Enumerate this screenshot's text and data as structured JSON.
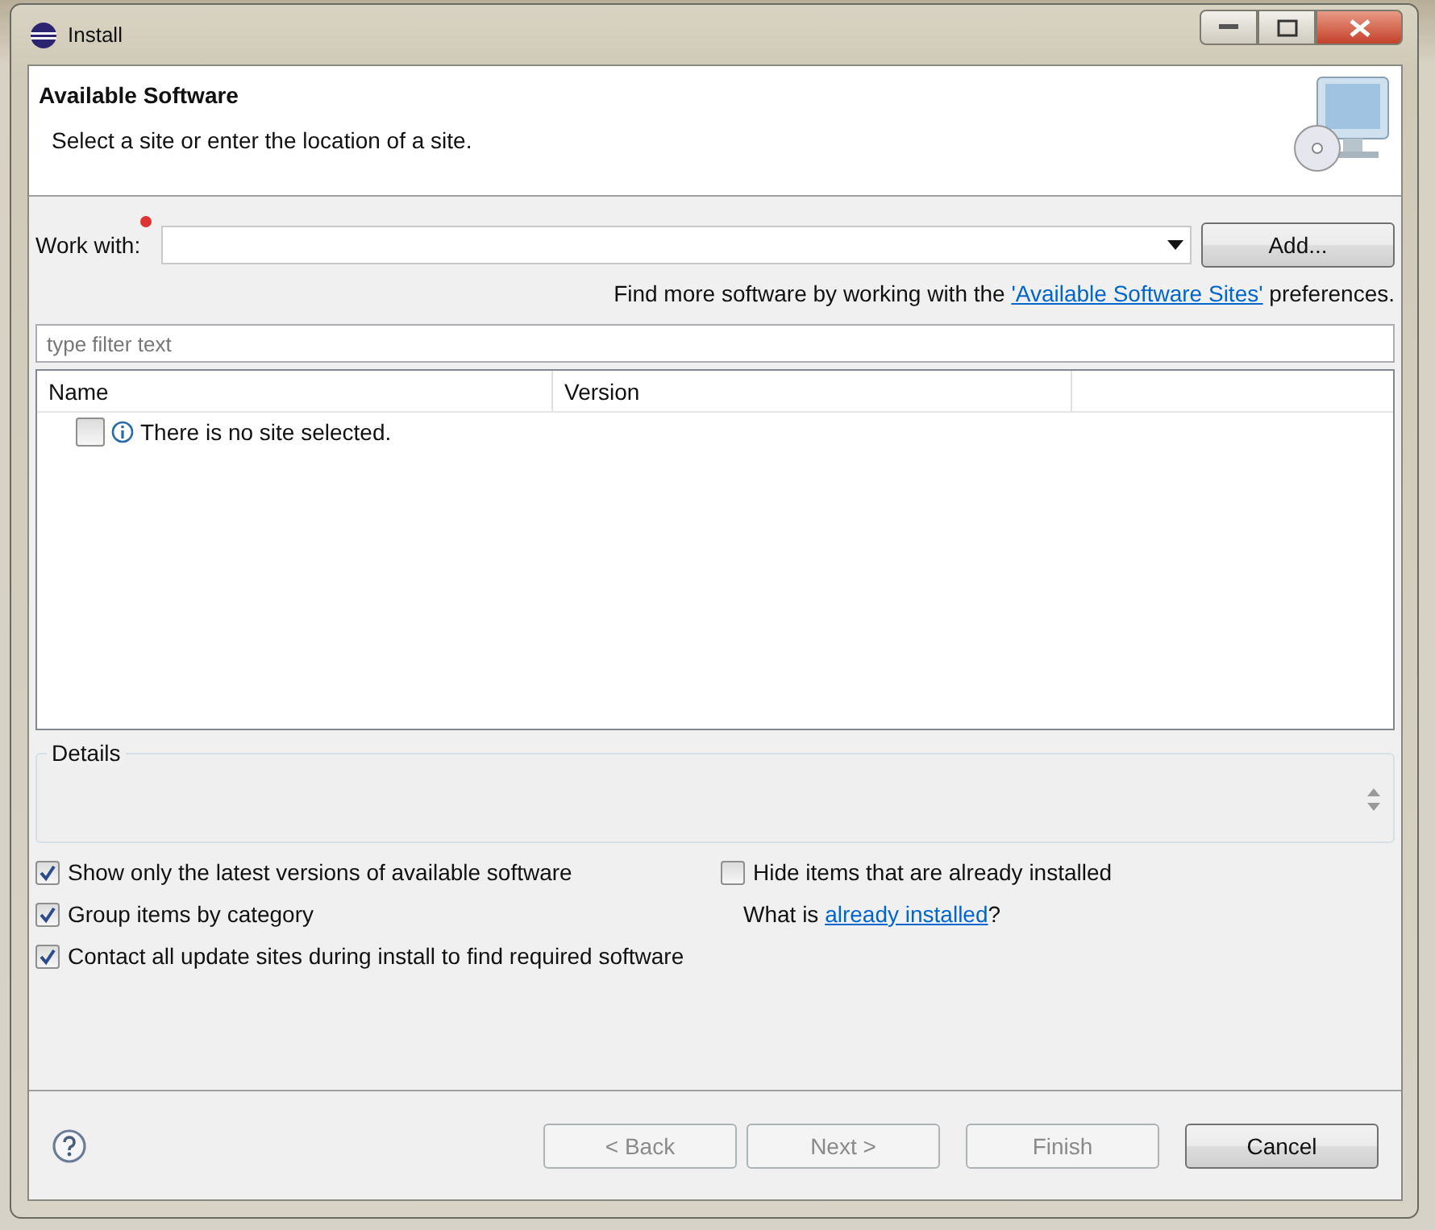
{
  "window": {
    "title": "Install"
  },
  "header": {
    "title": "Available Software",
    "subtitle": "Select a site or enter the location of a site."
  },
  "work_with": {
    "label": "Work with:",
    "required": true,
    "add_button": "Add..."
  },
  "sites_hint": {
    "before": "Find more software by working with the ",
    "link": "'Available Software Sites'",
    "after": " preferences."
  },
  "filter": {
    "placeholder": "type filter text"
  },
  "table": {
    "columns": [
      "Name",
      "Version"
    ],
    "rows": [
      {
        "text": "There is no site selected.",
        "checked": false
      }
    ]
  },
  "details": {
    "label": "Details"
  },
  "options_left": [
    {
      "label": "Show only the latest versions of available software",
      "checked": true
    },
    {
      "label": "Group items by category",
      "checked": true
    },
    {
      "label": "Contact all update sites during install to find required software",
      "checked": true
    }
  ],
  "options_right": [
    {
      "label": "Hide items that are already installed",
      "checked": false
    }
  ],
  "installed_hint": {
    "before": "What is ",
    "link": "already installed",
    "after": "?"
  },
  "buttons": [
    {
      "label": "< Back",
      "disabled": true
    },
    {
      "label": "Next >",
      "disabled": true
    },
    {
      "label": "Finish",
      "disabled": true
    },
    {
      "label": "Cancel",
      "disabled": false
    }
  ]
}
